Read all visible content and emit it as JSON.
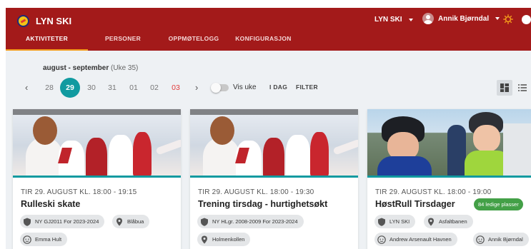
{
  "app": {
    "title": "LYN SKI"
  },
  "header": {
    "club_select": "LYN SKI",
    "user_name": "Annik Bjørndal"
  },
  "tabs": [
    {
      "label": "AKTIVITETER",
      "active": true
    },
    {
      "label": "PERSONER",
      "active": false
    },
    {
      "label": "OPPMØTELOGG",
      "active": false
    },
    {
      "label": "KONFIGURASJON",
      "active": false
    }
  ],
  "calendar": {
    "period": "august - september",
    "week": "(Uke 35)",
    "days": [
      {
        "label": "28",
        "selected": false,
        "red": false
      },
      {
        "label": "29",
        "selected": true,
        "red": false
      },
      {
        "label": "30",
        "selected": false,
        "red": false
      },
      {
        "label": "31",
        "selected": false,
        "red": false
      },
      {
        "label": "01",
        "selected": false,
        "red": false
      },
      {
        "label": "02",
        "selected": false,
        "red": false
      },
      {
        "label": "03",
        "selected": false,
        "red": true
      }
    ],
    "prev_arrow": "‹",
    "next_arrow": "›",
    "vis_uke": "Vis uke",
    "today_label": "I DAG",
    "filter_label": "FILTER"
  },
  "cards": [
    {
      "date": "TIR 29. AUGUST KL. 18:00 - 19:15",
      "title": "Rulleski skate",
      "group": "NY GJ2011 For 2023-2024",
      "location": "Blåbua",
      "coach": "Emma Hult"
    },
    {
      "date": "TIR 29. AUGUST KL. 18:00 - 19:30",
      "title": "Trening tirsdag - hurtighetsøkt",
      "group": "NY HLgr. 2008-2009 For 2023-2024",
      "location": "Holmenkollen"
    },
    {
      "date": "TIR 29. AUGUST KL. 18:00 - 19:00",
      "title": "HøstRull Tirsdager",
      "badge": "84 ledige plasser",
      "group": "LYN SKI",
      "location": "Asfaltbanen",
      "coach": "Andrew Arsenault Havnen",
      "coach2": "Annik Bjørndal"
    }
  ],
  "colors": {
    "header": "#a31a1a",
    "accent": "#119aa0",
    "tab_indicator": "#f39b1b",
    "badge": "#43a047",
    "sunday": "#e23a3a"
  },
  "icons": [
    "club-logo",
    "chevron-down-icon",
    "user-avatar-icon",
    "sun-icon",
    "chevron-left-icon",
    "chevron-right-icon",
    "grid-view-icon",
    "list-view-icon",
    "shield-icon",
    "location-pin-icon",
    "face-icon"
  ]
}
